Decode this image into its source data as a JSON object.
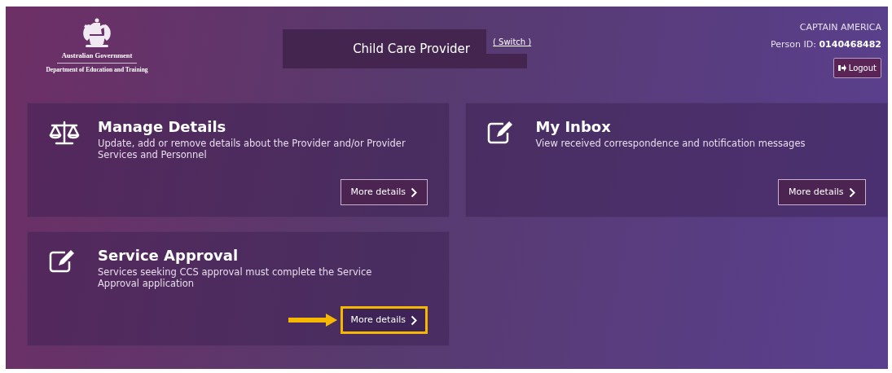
{
  "header": {
    "logo": {
      "line_1": "Australian Government",
      "line_2": "Department of Education and Training"
    },
    "role": "Child Care Provider",
    "switch_link": "( Switch )",
    "user": {
      "name": "CAPTAIN AMERICA",
      "person_id_label": "Person ID:",
      "person_id": "0140468482",
      "logout": "Logout"
    }
  },
  "cards": [
    {
      "kind": "scales",
      "title": "Manage Details",
      "description": "Update, add or remove details about the Provider and/or Provider Services and Personnel",
      "button": "More details",
      "highlighted": false
    },
    {
      "kind": "edit",
      "title": "My Inbox",
      "description": "View received correspondence and notification messages",
      "button": "More details",
      "highlighted": false
    },
    {
      "kind": "edit",
      "title": "Service Approval",
      "description": "Services seeking CCS approval must complete the Service Approval application",
      "button": "More details",
      "highlighted": true
    }
  ]
}
